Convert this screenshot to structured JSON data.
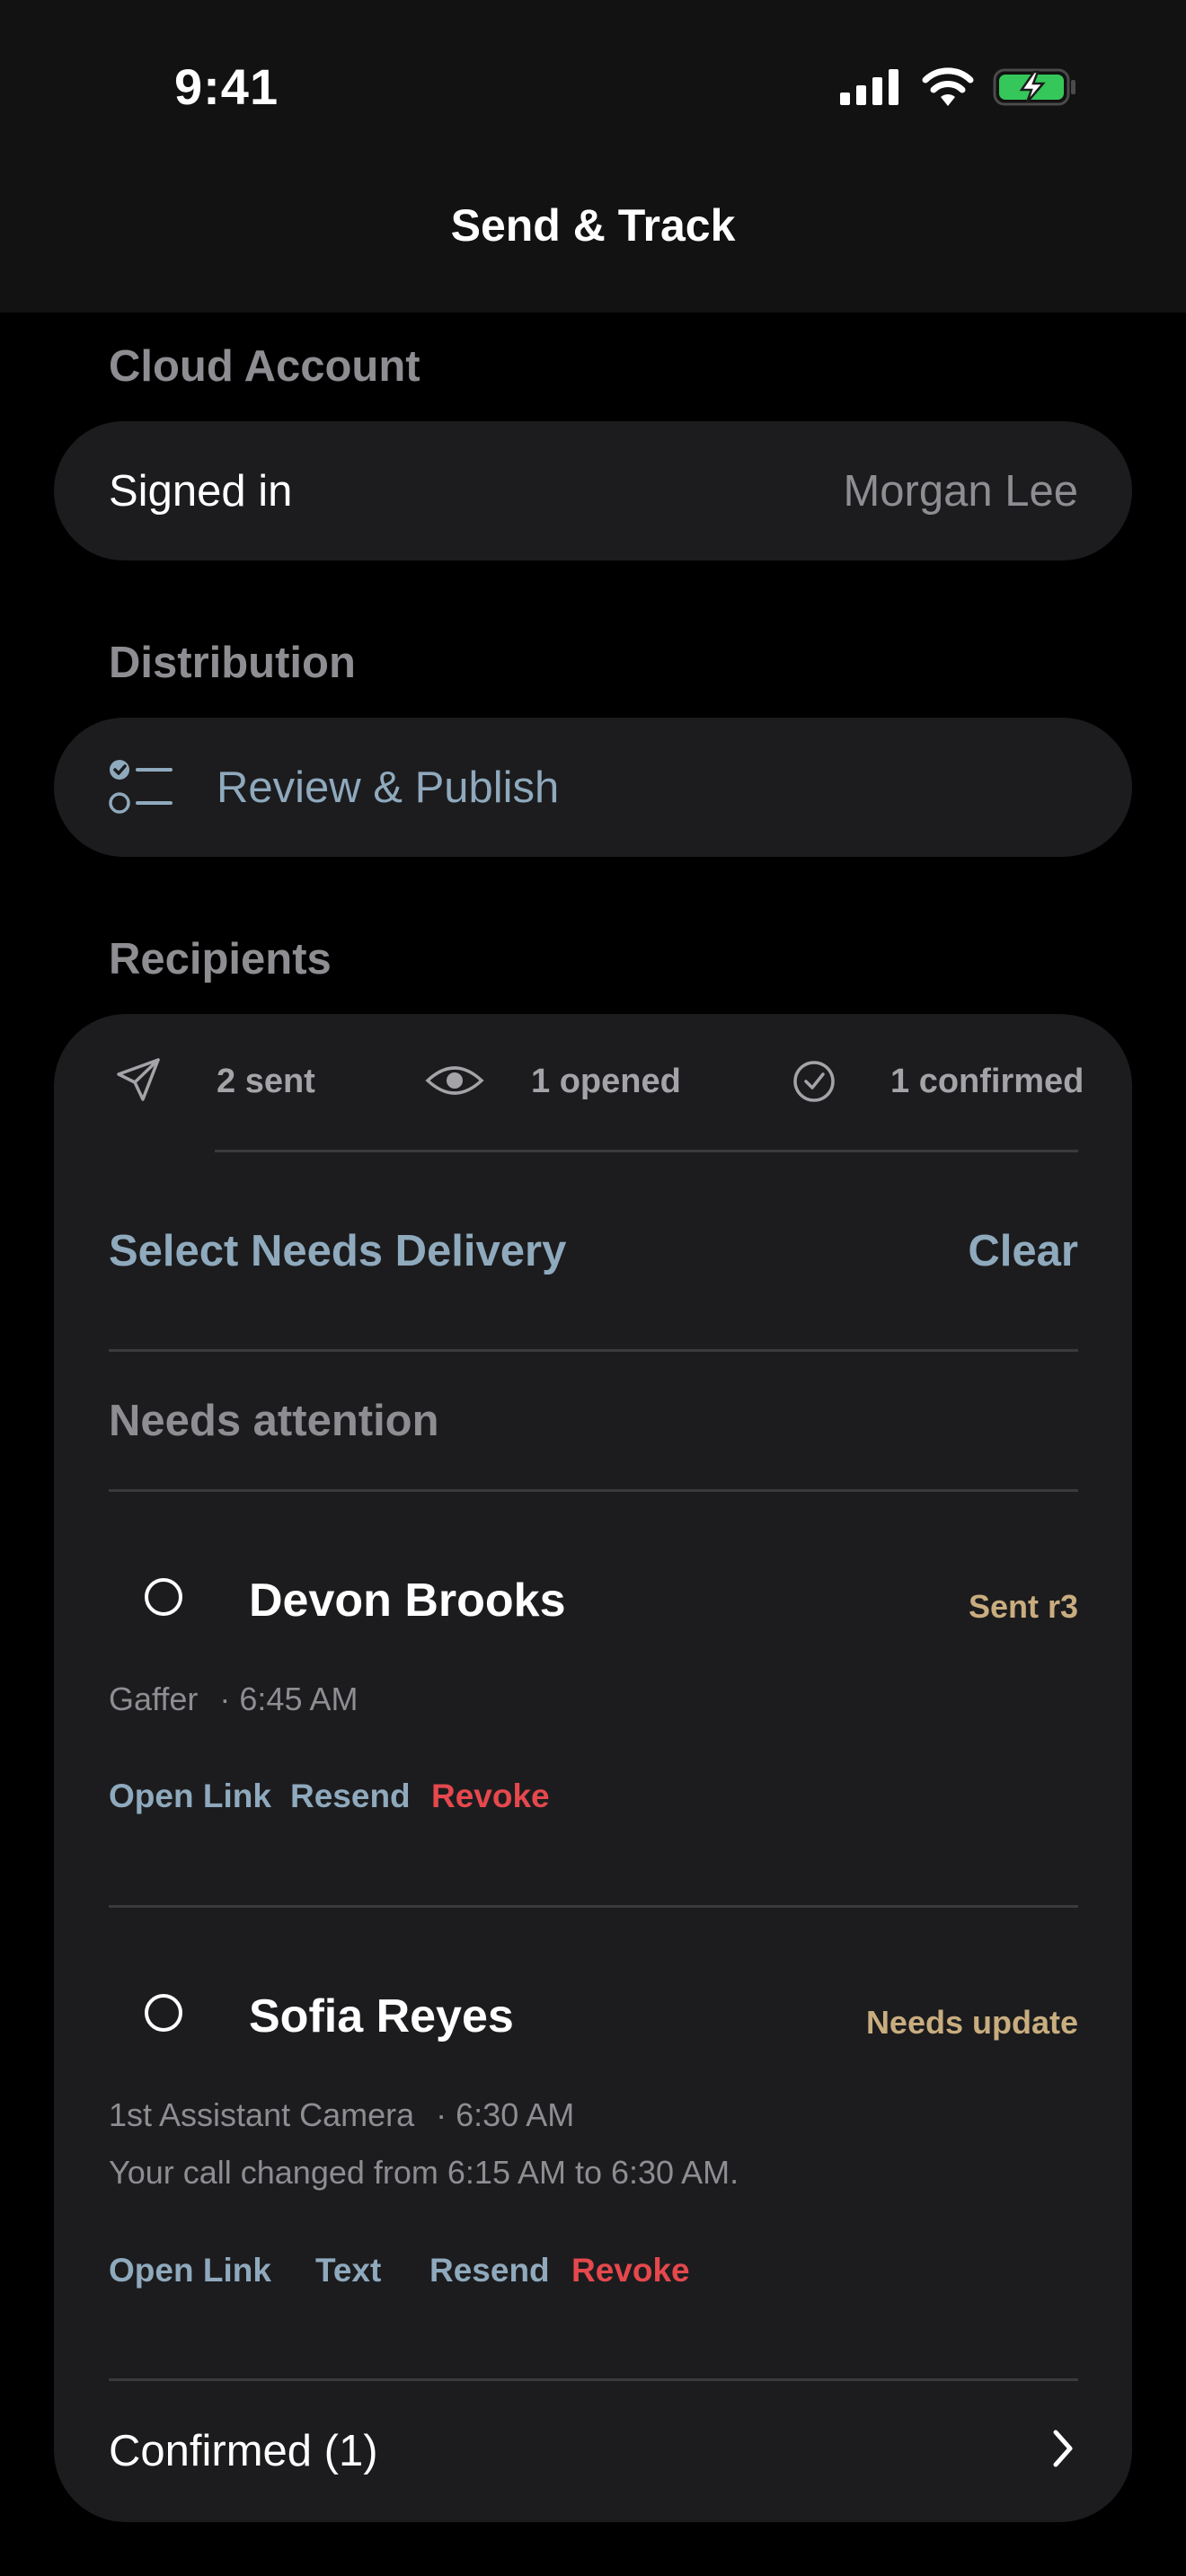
{
  "status_bar": {
    "time": "9:41"
  },
  "nav": {
    "title": "Send & Track"
  },
  "cloud_account": {
    "section_label": "Cloud Account",
    "signed_in_label": "Signed in",
    "user_name": "Morgan Lee"
  },
  "distribution": {
    "section_label": "Distribution",
    "review_label": "Review & Publish"
  },
  "recipients": {
    "section_label": "Recipients",
    "stats": {
      "sent": "2 sent",
      "opened": "1 opened",
      "confirmed": "1 confirmed"
    },
    "select_label": "Select Needs Delivery",
    "clear_label": "Clear",
    "needs_attention_label": "Needs attention",
    "people": [
      {
        "name": "Devon Brooks",
        "badge": "Sent r3",
        "role": "Gaffer",
        "time": "· 6:45 AM",
        "note": "",
        "actions": {
          "open_link": "Open Link",
          "resend": "Resend",
          "revoke": "Revoke"
        }
      },
      {
        "name": "Sofia Reyes",
        "badge": "Needs update",
        "role": "1st Assistant Camera",
        "time": "· 6:30 AM",
        "note": "Your call changed from 6:15 AM to 6:30 AM.",
        "actions": {
          "open_link": "Open Link",
          "text": "Text",
          "resend": "Resend",
          "revoke": "Revoke"
        }
      }
    ],
    "confirmed_label": "Confirmed (1)"
  },
  "colors": {
    "accent_blue": "#8fa9bd",
    "destructive_red": "#e5484d",
    "badge_gold": "#c9ad7f",
    "battery_green": "#35c759"
  },
  "icons": {
    "status": [
      "cellular-signal-icon",
      "wifi-icon",
      "battery-charging-icon"
    ],
    "distribution": "checklist-icon",
    "stats": [
      "paper-plane-icon",
      "eye-icon",
      "checkmark-circle-icon"
    ],
    "radio": "radio-unselected-icon",
    "confirmed": "chevron-right-icon"
  }
}
